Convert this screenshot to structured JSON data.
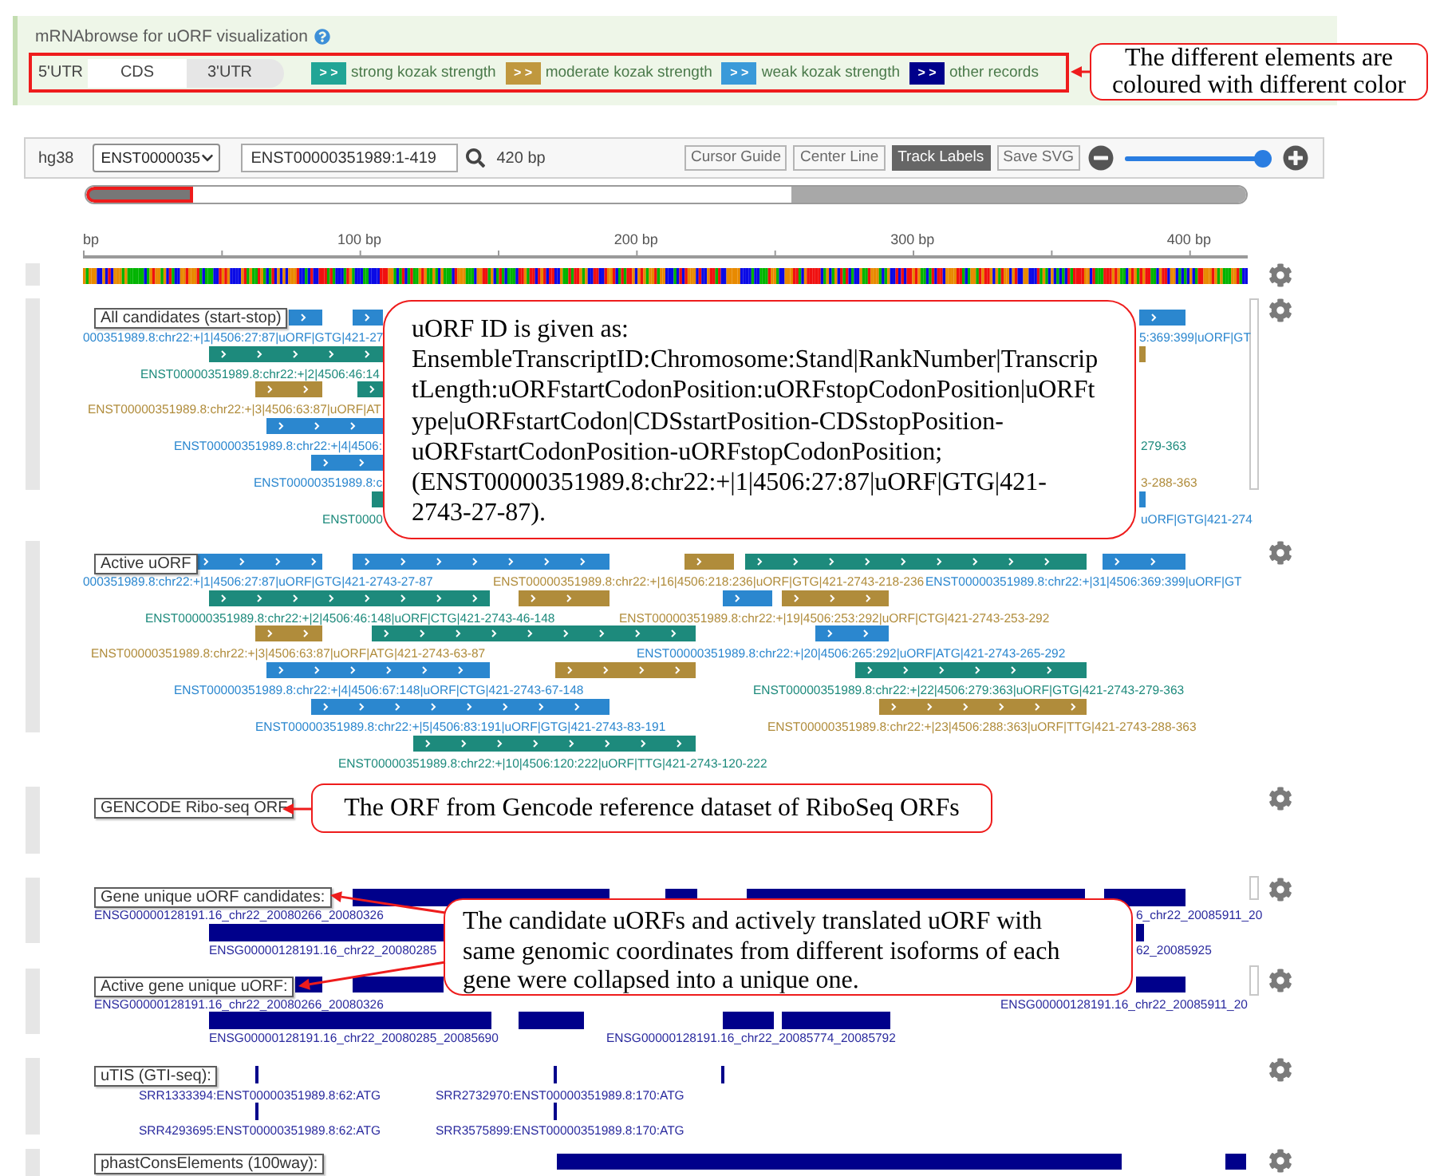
{
  "header": {
    "title": "mRNAbrowse for uORF visualization",
    "regions": [
      {
        "label": "5'UTR",
        "kind": "utr5"
      },
      {
        "label": "CDS",
        "kind": "cds"
      },
      {
        "label": "3'UTR",
        "kind": "utr3"
      }
    ],
    "legend": [
      {
        "symbol": "> >",
        "label": "strong kozak strength",
        "color": "#22a596"
      },
      {
        "symbol": "> >",
        "label": "moderate kozak strength",
        "color": "#c0983e"
      },
      {
        "symbol": "> >",
        "label": "weak kozak strength",
        "color": "#3a9ad9"
      },
      {
        "symbol": "> >",
        "label": "other records",
        "color": "#00008b"
      }
    ]
  },
  "toolbar": {
    "genome": "hg38",
    "transcript": "ENST0000035",
    "locus": "ENST00000351989:1-419",
    "length": "420 bp",
    "buttons": [
      {
        "label": "Cursor Guide",
        "selected": false
      },
      {
        "label": "Center Line",
        "selected": false
      },
      {
        "label": "Track Labels",
        "selected": true
      },
      {
        "label": "Save SVG",
        "selected": false
      }
    ],
    "zoom": {
      "level": 0.94
    }
  },
  "ruler": {
    "ticks": [
      "bp",
      "100 bp",
      "200 bp",
      "300 bp",
      "400 bp"
    ]
  },
  "tracks": [
    {
      "label": "All candidates (start-stop)",
      "kind": "uorf",
      "bars": [
        {
          "color": "#2b87cf"
        },
        {
          "color": "#2b87cf"
        },
        {
          "color": "#2b87cf"
        },
        {
          "color": "#1d8a7c"
        },
        {
          "color": "#b08c3b"
        },
        {
          "color": "#b08c3b"
        },
        {
          "color": "#1d8a7c"
        },
        {
          "color": "#2b87cf"
        },
        {
          "color": "#2b87cf"
        },
        {
          "color": "#1d8a7c"
        },
        {
          "color": "#2b87cf"
        }
      ],
      "labels": [
        {
          "text": "000351989.8:chr22:+|1|4506:27:87|uORF|GTG|421-27",
          "color": "#2b87cf"
        },
        {
          "text": "5:369:399|uORF|GT",
          "color": "#2b87cf"
        },
        {
          "text": "ENST00000351989.8:chr22:+|2|4506:46:14",
          "color": "#1d8a7c"
        },
        {
          "text": "ENST00000351989.8:chr22:+|3|4506:63:87|uORF|AT",
          "color": "#b08c3b"
        },
        {
          "text": "ENST00000351989.8:chr22:+|4|4506:",
          "color": "#2b87cf"
        },
        {
          "text": "279-363",
          "color": "#1d8a7c"
        },
        {
          "text": "ENST00000351989.8:c",
          "color": "#2b87cf"
        },
        {
          "text": "3-288-363",
          "color": "#b08c3b"
        },
        {
          "text": "ENST0000",
          "color": "#1d8a7c"
        },
        {
          "text": "uORF|GTG|421-274",
          "color": "#2b87cf"
        }
      ]
    },
    {
      "label": "Active uORF",
      "kind": "uorf",
      "bars": [
        {
          "color": "#2b87cf"
        },
        {
          "color": "#2b87cf"
        },
        {
          "color": "#b08c3b"
        },
        {
          "color": "#1d8a7c"
        },
        {
          "color": "#2b87cf"
        },
        {
          "color": "#1d8a7c"
        },
        {
          "color": "#b08c3b"
        },
        {
          "color": "#2b87cf"
        },
        {
          "color": "#b08c3b"
        },
        {
          "color": "#b08c3b"
        },
        {
          "color": "#1d8a7c"
        },
        {
          "color": "#2b87cf"
        },
        {
          "color": "#2b87cf"
        },
        {
          "color": "#b08c3b"
        },
        {
          "color": "#1d8a7c"
        },
        {
          "color": "#2b87cf"
        },
        {
          "color": "#b08c3b"
        },
        {
          "color": "#1d8a7c"
        }
      ],
      "labels": [
        {
          "text": "000351989.8:chr22:+|1|4506:27:87|uORF|GTG|421-2743-27-87",
          "color": "#2b87cf"
        },
        {
          "text": "ENST00000351989.8:chr22:+|16|4506:218:236|uORF|GTG|421-2743-218-236",
          "color": "#b08c3b"
        },
        {
          "text": "ENST00000351989.8:chr22:+|31|4506:369:399|uORF|GT",
          "color": "#2b87cf"
        },
        {
          "text": "ENST00000351989.8:chr22:+|2|4506:46:148|uORF|CTG|421-2743-46-148",
          "color": "#1d8a7c"
        },
        {
          "text": "ENST00000351989.8:chr22:+|19|4506:253:292|uORF|CTG|421-2743-253-292",
          "color": "#b08c3b"
        },
        {
          "text": "ENST00000351989.8:chr22:+|3|4506:63:87|uORF|ATG|421-2743-63-87",
          "color": "#b08c3b"
        },
        {
          "text": "ENST00000351989.8:chr22:+|20|4506:265:292|uORF|ATG|421-2743-265-292",
          "color": "#2b87cf"
        },
        {
          "text": "ENST00000351989.8:chr22:+|4|4506:67:148|uORF|CTG|421-2743-67-148",
          "color": "#2b87cf"
        },
        {
          "text": "ENST00000351989.8:chr22:+|22|4506:279:363|uORF|GTG|421-2743-279-363",
          "color": "#1d8a7c"
        },
        {
          "text": "ENST00000351989.8:chr22:+|5|4506:83:191|uORF|GTG|421-2743-83-191",
          "color": "#2b87cf"
        },
        {
          "text": "ENST00000351989.8:chr22:+|23|4506:288:363|uORF|TTG|421-2743-288-363",
          "color": "#b08c3b"
        },
        {
          "text": "ENST00000351989.8:chr22:+|10|4506:120:222|uORF|TTG|421-2743-120-222",
          "color": "#1d8a7c"
        }
      ]
    },
    {
      "label": "GENCODE Ribo-seq ORF",
      "kind": "orf"
    },
    {
      "label": "Gene unique uORF candidates:",
      "kind": "gene",
      "labels": [
        {
          "text": "ENSG00000128191.16_chr22_20080266_20080326"
        },
        {
          "text": "6_chr22_20085911_20"
        },
        {
          "text": "ENSG00000128191.16_chr22_20080285"
        },
        {
          "text": "62_20085925"
        }
      ]
    },
    {
      "label": "Active gene unique uORF:",
      "kind": "gene",
      "labels": [
        {
          "text": "ENSG00000128191.16_chr22_20080266_20080326"
        },
        {
          "text": "ENSG00000128191.16_chr22_20085911_20"
        },
        {
          "text": "ENSG00000128191.16_chr22_20080285_20085690"
        },
        {
          "text": "ENSG00000128191.16_chr22_20085774_20085792"
        }
      ]
    },
    {
      "label": "uTIS (GTI-seq):",
      "kind": "tis",
      "labels": [
        {
          "text": "SRR1333394:ENST00000351989.8:62:ATG"
        },
        {
          "text": "SRR2732970:ENST00000351989.8:170:ATG"
        },
        {
          "text": "SRR4293695:ENST00000351989.8:62:ATG"
        },
        {
          "text": "SRR3575899:ENST00000351989.8:170:ATG"
        }
      ]
    },
    {
      "label": "phastConsElements (100way):",
      "kind": "conservation"
    }
  ],
  "annotations": [
    {
      "text": "The different elements are coloured with different color"
    },
    {
      "text": "uORF ID is given as: EnsembleTranscriptID:Chromosome:Stand|RankNumber|TranscriptLength:uORFstartCodonPosition:uORFstopCodonPosition|uORFtype|uORFstartCodon|CDSstartPosition-CDSstopPosition-uORFstartCodonPosition-uORFstopCodonPosition; (ENST00000351989.8:chr22:+|1|4506:27:87|uORF|GTG|421-2743-27-87)."
    },
    {
      "text": "The ORF from Gencode reference dataset of RiboSeq ORFs"
    },
    {
      "text": "The candidate uORFs and actively translated uORF with same genomic coordinates from different isoforms of each gene were collapsed into a unique one."
    }
  ]
}
